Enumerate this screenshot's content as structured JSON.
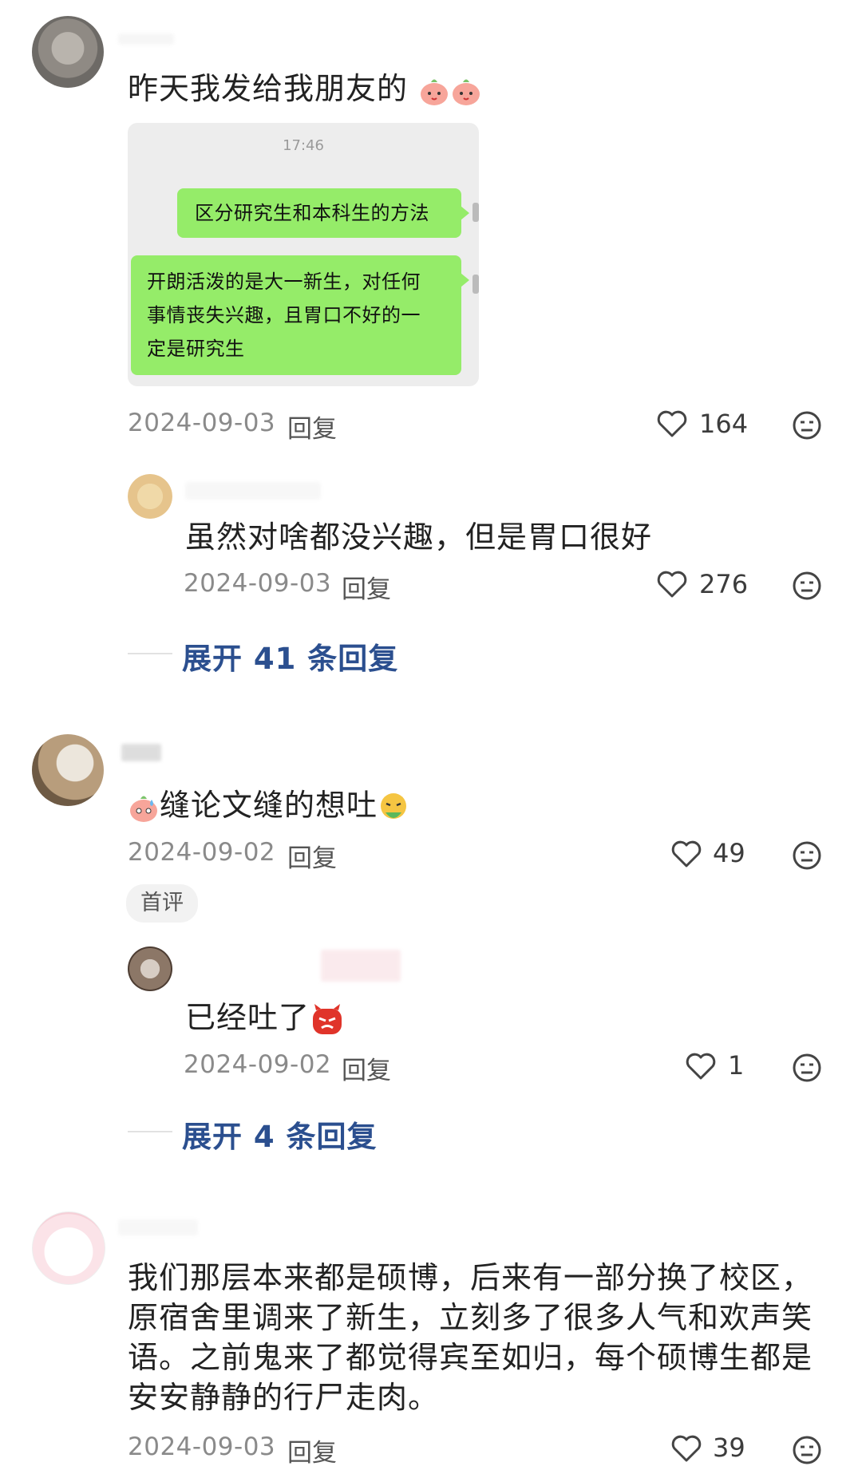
{
  "comments": [
    {
      "text": "昨天我发给我朋友的",
      "emojis": [
        "peach-emoji",
        "peach-emoji"
      ],
      "screenshot": {
        "time": "17:46",
        "bubble1": "区分研究生和本科生的方法",
        "bubble2_line1": "开朗活泼的是大一新生，对任何",
        "bubble2_line2": "事情丧失兴趣，且胃口不好的一",
        "bubble2_line3": "定是研究生"
      },
      "date": "2024-09-03",
      "reply_label": "回复",
      "likes": "164",
      "replies": [
        {
          "text": "虽然对啥都没兴趣，但是胃口很好",
          "date": "2024-09-03",
          "reply_label": "回复",
          "likes": "276"
        }
      ],
      "expand_label": "展开 41 条回复"
    },
    {
      "text": "缝论文缝的想吐",
      "emojis": [
        "sweat-peach-emoji",
        "vomit-emoji"
      ],
      "date": "2024-09-02",
      "reply_label": "回复",
      "likes": "49",
      "tag": "首评",
      "replies": [
        {
          "text": "已经吐了",
          "emoji": "angry-devil-emoji",
          "date": "2024-09-02",
          "reply_label": "回复",
          "likes": "1"
        }
      ],
      "expand_label": "展开 4 条回复"
    },
    {
      "text": "我们那层本来都是硕博，后来有一部分换了校区，原宿舍里调来了新生，立刻多了很多人气和欢声笑语。之前鬼来了都觉得宾至如归，每个硕博生都是安安静静的行尸走肉。",
      "date": "2024-09-03",
      "reply_label": "回复",
      "likes": "39"
    }
  ],
  "colors": {
    "bubble_green": "#95ec69",
    "expand_link": "#2b4f8f",
    "muted": "#8a8a8a"
  }
}
